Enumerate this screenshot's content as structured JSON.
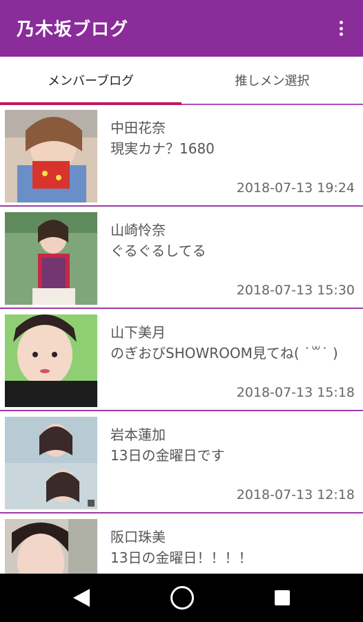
{
  "app": {
    "title": "乃木坂ブログ"
  },
  "tabs": [
    {
      "label": "メンバーブログ",
      "active": true
    },
    {
      "label": "推しメン選択",
      "active": false
    }
  ],
  "colors": {
    "appbar": "#8a2c9a",
    "indicator": "#c2185b",
    "divider": "#9c3aa6"
  },
  "posts": [
    {
      "member": "中田花奈",
      "excerpt": "現実カナ？1680",
      "datetime": "2018-07-13 19:24"
    },
    {
      "member": "山崎怜奈",
      "excerpt": "ぐるぐるしてる",
      "datetime": "2018-07-13 15:30"
    },
    {
      "member": "山下美月",
      "excerpt": "のぎおびSHOWROOM見てね( ˙꒳˙ )",
      "datetime": "2018-07-13 15:18"
    },
    {
      "member": "岩本蓮加",
      "excerpt": "13日の金曜日です",
      "datetime": "2018-07-13 12:18"
    },
    {
      "member": "阪口珠美",
      "excerpt": "13日の金曜日！！！！",
      "datetime": ""
    }
  ],
  "navigation": {
    "icons": [
      "back-icon",
      "home-icon",
      "recents-icon"
    ]
  }
}
